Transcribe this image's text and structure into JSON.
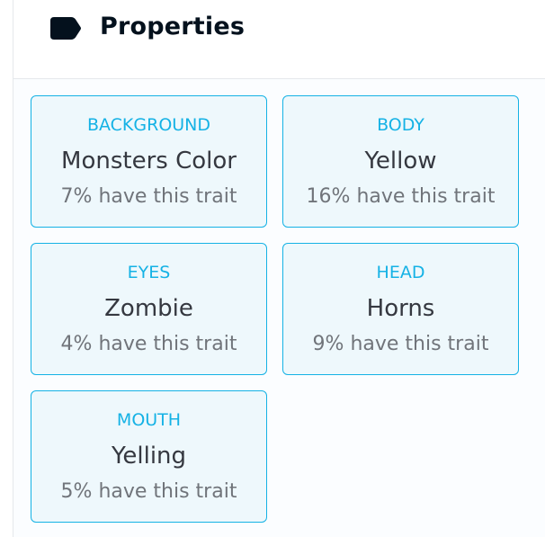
{
  "header": {
    "title": "Properties",
    "icon": "label-tag-icon"
  },
  "traits": [
    {
      "type": "BACKGROUND",
      "value": "Monsters Color",
      "rarity": "7% have this trait"
    },
    {
      "type": "BODY",
      "value": "Yellow",
      "rarity": "16% have this trait"
    },
    {
      "type": "EYES",
      "value": "Zombie",
      "rarity": "4% have this trait"
    },
    {
      "type": "HEAD",
      "value": "Horns",
      "rarity": "9% have this trait"
    },
    {
      "type": "MOUTH",
      "value": "Yelling",
      "rarity": "5% have this trait"
    }
  ],
  "colors": {
    "accent": "#15b2e5",
    "card_bg": "#eef8fc",
    "title": "#04111d",
    "value_text": "#353840",
    "muted_text": "#70747a"
  }
}
